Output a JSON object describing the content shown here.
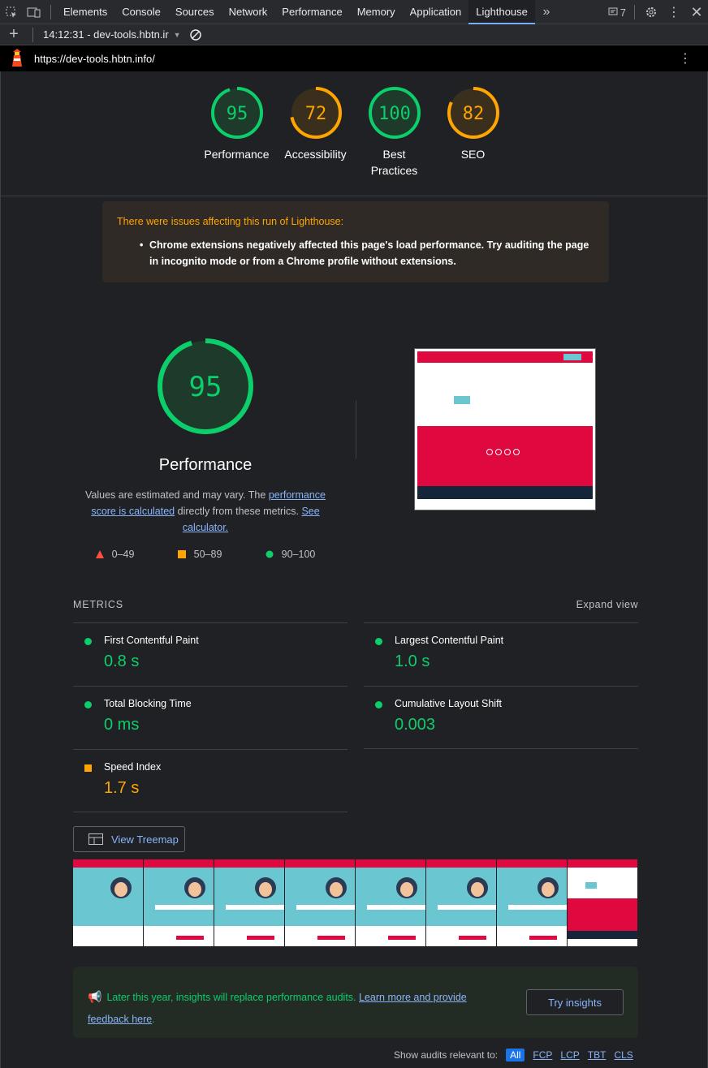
{
  "devtools": {
    "tabs": [
      {
        "label": "Elements"
      },
      {
        "label": "Console"
      },
      {
        "label": "Sources"
      },
      {
        "label": "Network"
      },
      {
        "label": "Performance"
      },
      {
        "label": "Memory"
      },
      {
        "label": "Application"
      },
      {
        "label": "Lighthouse"
      }
    ],
    "active_tab": "Lighthouse",
    "issues_count": "7",
    "report_selector": "14:12:31 - dev-tools.hbtn.ir"
  },
  "report": {
    "url": "https://dev-tools.hbtn.info/",
    "categories": [
      {
        "label": "Performance",
        "score": "95",
        "value": 95,
        "color": "#0cce6b",
        "bg": "#1e3a2a"
      },
      {
        "label": "Accessibility",
        "score": "72",
        "value": 72,
        "color": "#ffa400",
        "bg": "#3a2f1d"
      },
      {
        "label": "Best Practices",
        "score": "100",
        "value": 100,
        "color": "#0cce6b",
        "bg": "#1e3a2a"
      },
      {
        "label": "SEO",
        "score": "82",
        "value": 82,
        "color": "#ffa400",
        "bg": "#3a2f1d"
      }
    ],
    "warning": {
      "title": "There were issues affecting this run of Lighthouse:",
      "item": "Chrome extensions negatively affected this page's load performance. Try auditing the page in incognito mode or from a Chrome profile without extensions."
    },
    "performance": {
      "score": "95",
      "value": 95,
      "title": "Performance",
      "desc_prefix": "Values are estimated and may vary. The ",
      "desc_link1": "performance score is calculated",
      "desc_middle": " directly from these metrics. ",
      "desc_link2": "See calculator.",
      "legend": [
        "0–49",
        "50–89",
        "90–100"
      ]
    },
    "metrics_header": "METRICS",
    "expand_view": "Expand view",
    "metrics": [
      {
        "name": "First Contentful Paint",
        "value": "0.8 s",
        "status": "good"
      },
      {
        "name": "Largest Contentful Paint",
        "value": "1.0 s",
        "status": "good"
      },
      {
        "name": "Total Blocking Time",
        "value": "0 ms",
        "status": "good"
      },
      {
        "name": "Cumulative Layout Shift",
        "value": "0.003",
        "status": "good"
      },
      {
        "name": "Speed Index",
        "value": "1.7 s",
        "status": "average"
      }
    ],
    "view_treemap": "View Treemap",
    "insights": {
      "text": "Later this year, insights will replace performance audits. ",
      "link": "Learn more and provide feedback here",
      "end": ".",
      "button": "Try insights"
    },
    "filter": {
      "label": "Show audits relevant to:",
      "options": [
        "All",
        "FCP",
        "LCP",
        "TBT",
        "CLS"
      ]
    }
  },
  "colors": {
    "good": "#0cce6b",
    "average": "#ffa400",
    "poor": "#ff4e42"
  }
}
